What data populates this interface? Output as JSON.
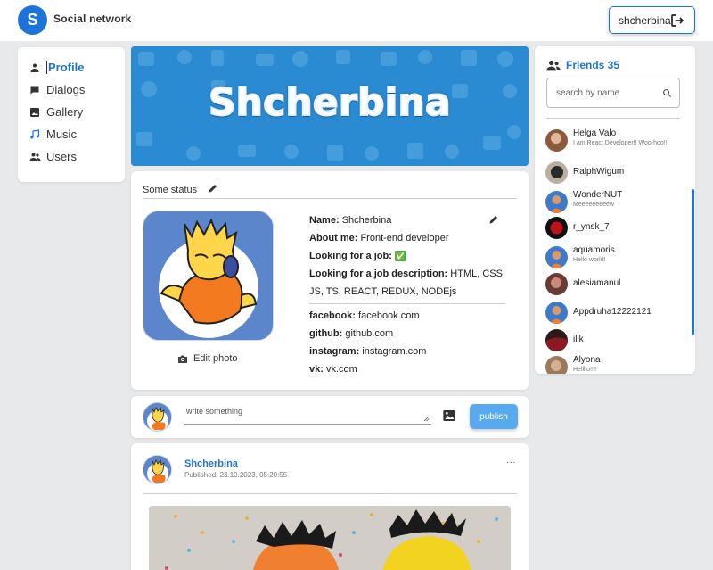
{
  "header": {
    "logo_letter": "S",
    "brand": "Social network",
    "login_label": "shcherbina"
  },
  "nav": {
    "items": [
      {
        "label": "Profile",
        "icon": "person-icon",
        "active": true
      },
      {
        "label": "Dialogs",
        "icon": "chat-icon",
        "active": false
      },
      {
        "label": "Gallery",
        "icon": "gallery-icon",
        "active": false
      },
      {
        "label": "Music",
        "icon": "music-icon",
        "active": false
      },
      {
        "label": "Users",
        "icon": "users-icon",
        "active": false
      }
    ]
  },
  "banner": {
    "title": "Shcherbina"
  },
  "profile": {
    "status": "Some status",
    "edit_photo": "Edit photo",
    "name_label": "Name:",
    "name": "Shcherbina",
    "about_label": "About me:",
    "about": "Front-end developer",
    "job_label": "Looking for a job:",
    "job_value": "✅",
    "job_desc_label": "Looking for a job description:",
    "job_desc": "HTML, CSS, JS, TS, REACT, REDUX, NODEjs",
    "contacts": [
      {
        "label": "facebook:",
        "value": "facebook.com"
      },
      {
        "label": "github:",
        "value": "github.com"
      },
      {
        "label": "instagram:",
        "value": "instagram.com"
      },
      {
        "label": "vk:",
        "value": "vk.com"
      }
    ]
  },
  "newpost": {
    "placeholder": "write something",
    "publish_label": "publish"
  },
  "post": {
    "author": "Shcherbina",
    "date": "Published: 23.10.2023, 05:20:55",
    "more": "..."
  },
  "friends": {
    "title": "Friends 35",
    "search_placeholder": "search by name",
    "list": [
      {
        "name": "Helga Valo",
        "status": "I am React Developer!! Woo-hoo!!!"
      },
      {
        "name": "RalphWigum",
        "status": ""
      },
      {
        "name": "WonderNUT",
        "status": "Meeeeeeeeew"
      },
      {
        "name": "r_ynsk_7",
        "status": ""
      },
      {
        "name": "aquamoris",
        "status": "Hello world!"
      },
      {
        "name": "alesiamanul",
        "status": ""
      },
      {
        "name": "Appdruha12222121",
        "status": ""
      },
      {
        "name": "ilik",
        "status": ""
      },
      {
        "name": "Alyona",
        "status": "Hellllo!!!!"
      }
    ]
  },
  "colors": {
    "accent": "#1e73d6",
    "publish": "#57a9f0",
    "background": "#e8e9eb"
  }
}
